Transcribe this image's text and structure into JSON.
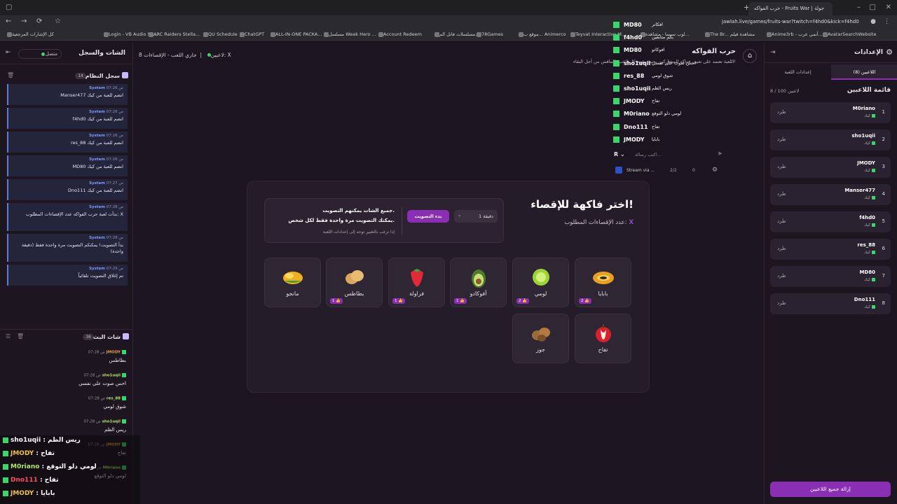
{
  "browser": {
    "tab_title": "حرب الفواكه - Fruits War | جولة",
    "url": "jawlah.live/games/fruits-war?twitch=f4hd0&kick=f4hd0",
    "bookmarks": [
      "كل الإشارات المرجعية",
      "Login - VB Audio So...",
      "ARC Raiders Stella...",
      "QU Schedule",
      "ChatGPT",
      "ALL-IN-ONE PACKA...",
      "مسلسل Weak Hero ...",
      "Account Redeem",
      "مسلسلات قاتل الم...",
      "78Games",
      "موقع ب... Animerco",
      "Teyvat Interactive M...",
      "لوب سينما - مشاهدة...",
      "The Br... مشاهدة فيلم",
      "Anime3rb - أنمي عرب...",
      "AvatarSearchWebsite"
    ]
  },
  "left": {
    "title": "الشات والسجل",
    "status": "متصل",
    "syslog_title": "سجل النظام",
    "syslog_count": "14",
    "syslog": [
      {
        "time": "07:26 ص",
        "src": "System",
        "text": "Manser477 انضم للعبة من كيك"
      },
      {
        "time": "07:26 ص",
        "src": "System",
        "text": "f4hd0 انضم للعبة من كيك"
      },
      {
        "time": "07:26 ص",
        "src": "System",
        "text": "res_88 انضم للعبة من كيك"
      },
      {
        "time": "07:26 ص",
        "src": "System",
        "text": "MD80 انضم للعبة من كيك"
      },
      {
        "time": "07:27 ص",
        "src": "System",
        "text": "Dno111 انضم للعبة من كيك"
      },
      {
        "time": "07:28 ص",
        "src": "System",
        "text": "بدأت لعبة حرب الفواكه عدد الإقصاءات المطلوب: X"
      },
      {
        "time": "07:28 ص",
        "src": "System",
        "text": "بدأ التصويت! يمكنكم التصويت مرة واحدة فقط (دقيقة واحدة)"
      },
      {
        "time": "07:29 ص",
        "src": "System",
        "text": "تم إغلاق التصويت تلقائياً"
      }
    ],
    "botchat_title": "شات البث",
    "botchat_count": "36",
    "chat": [
      {
        "time": "07:28 ص",
        "user": "JMODY",
        "text": "بطاطس"
      },
      {
        "time": "07:28 ص",
        "user": "sho1uqii",
        "text": "احس صوت على نفسي"
      },
      {
        "time": "07:28 ص",
        "user": "res_88",
        "text": "شوق لومي"
      },
      {
        "time": "07:28 ص",
        "user": "sho1uqii",
        "text": "ريس الظم"
      },
      {
        "time": "07:28 ص",
        "user": "JMODY",
        "text": "تفاح"
      },
      {
        "time": "07:28 ص",
        "user": "M0riano",
        "text": "لومي دلو التوقع"
      }
    ]
  },
  "overlay_chat": [
    {
      "user": "sho1uqii",
      "text": "ريس الظم"
    },
    {
      "user": "JMODY",
      "text": "تفاح"
    },
    {
      "user": "M0riano",
      "text": "لومي دلو التوقع"
    },
    {
      "user": "Dno111",
      "text": "تفاح"
    },
    {
      "user": "JMODY",
      "text": "بابايا"
    }
  ],
  "stream_chat": [
    {
      "user": "MD80",
      "text": "افكاتر"
    },
    {
      "user": "f4hd0",
      "text": "بكم متابعين"
    },
    {
      "user": "MD80",
      "text": "افوكاتو"
    },
    {
      "user": "sho1uqii",
      "text": "احس صوت على نفسي"
    },
    {
      "user": "res_88",
      "text": "شوق لومي"
    },
    {
      "user": "sho1uqii",
      "text": "ريس الظم"
    },
    {
      "user": "JMODY",
      "text": "تفاح"
    },
    {
      "user": "M0riano",
      "text": "لومي دلو التوقع"
    },
    {
      "user": "Dno111",
      "text": "تفاح"
    },
    {
      "user": "JMODY",
      "text": "بابايا"
    }
  ],
  "stream_input": {
    "placeholder": "اكتب رسالة...",
    "via": "Stream via ...",
    "viewers": "2/2",
    "count": "0"
  },
  "header": {
    "players_online": "8 لاعبين",
    "game_state": "جاري اللعب - الإقصاءات: X",
    "game_title": "حرب الفواكه",
    "game_desc": "اللعبة تعتمد على تعيين فواكه للمشاركين بحيث يقوم كل لاعب بالتنافس من أجل البقاء!"
  },
  "card": {
    "title": "اختر فاكهة للإقصاء!",
    "subtitle": "عدد الإقصاءات المطلوب:",
    "x_mark": "X",
    "vote_line1": "جميع الشات يمكنهم التصويت.",
    "vote_line2": "يمكنك التصويت مرة واحدة فقط لكل شخص.",
    "vote_line3": "إذا ترغب بالتغيير توجه إلى إعدادات اللعبة",
    "start_vote": "بدء التصويت",
    "duration": "1 دقيقة"
  },
  "fruits": [
    {
      "name": "بابايا",
      "votes": "2"
    },
    {
      "name": "لومي",
      "votes": "2"
    },
    {
      "name": "أفوكادو",
      "votes": "1"
    },
    {
      "name": "فراولة",
      "votes": "1"
    },
    {
      "name": "بطاطس",
      "votes": "1"
    },
    {
      "name": "مانجو",
      "votes": ""
    },
    {
      "name": "تفاح",
      "votes": ""
    },
    {
      "name": "جوز",
      "votes": ""
    }
  ],
  "right": {
    "title": "الإعدادات",
    "tab_players": "اللاعبين (8)",
    "tab_settings": "إعدادات اللعبة",
    "list_title": "قائمة اللاعبين",
    "list_count": "8 / 100 لاعبين",
    "kick_label": "طرد",
    "platform": "كيك",
    "players": [
      "M0riano",
      "sho1uqii",
      "JMODY",
      "Manser477",
      "f4hd0",
      "res_88",
      "MD80",
      "Dno111"
    ],
    "remove_all": "إزالة جميع اللاعبين"
  },
  "colors": {
    "accent": "#8a2fb3",
    "kick": "#38d66b",
    "bg": "#1c1420"
  }
}
